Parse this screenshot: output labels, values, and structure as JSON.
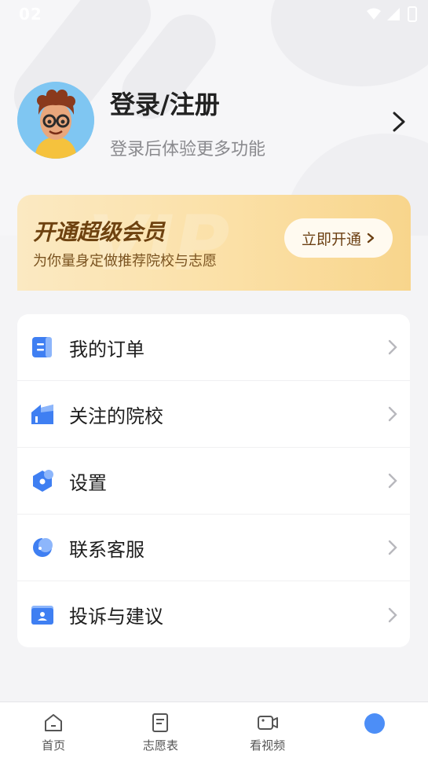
{
  "statusbar": {
    "time": "02"
  },
  "profile": {
    "title": "登录/注册",
    "subtitle": "登录后体验更多功能"
  },
  "vip": {
    "title": "开通超级会员",
    "subtitle": "为你量身定做推荐院校与志愿",
    "button_label": "立即开通"
  },
  "menu": {
    "items": [
      {
        "label": "我的订单",
        "icon": "order-icon"
      },
      {
        "label": "关注的院校",
        "icon": "school-icon"
      },
      {
        "label": "设置",
        "icon": "settings-icon"
      },
      {
        "label": "联系客服",
        "icon": "customer-service-icon"
      },
      {
        "label": "投诉与建议",
        "icon": "feedback-icon"
      }
    ]
  },
  "tabbar": {
    "items": [
      {
        "label": "首页",
        "icon": "home-icon"
      },
      {
        "label": "志愿表",
        "icon": "form-icon"
      },
      {
        "label": "看视频",
        "icon": "video-icon"
      },
      {
        "label": "",
        "icon": "profile-dot-icon"
      }
    ]
  },
  "colors": {
    "accent": "#4c8ef7",
    "vip_text": "#6e4210",
    "vip_bg": "#fbe0a6"
  }
}
